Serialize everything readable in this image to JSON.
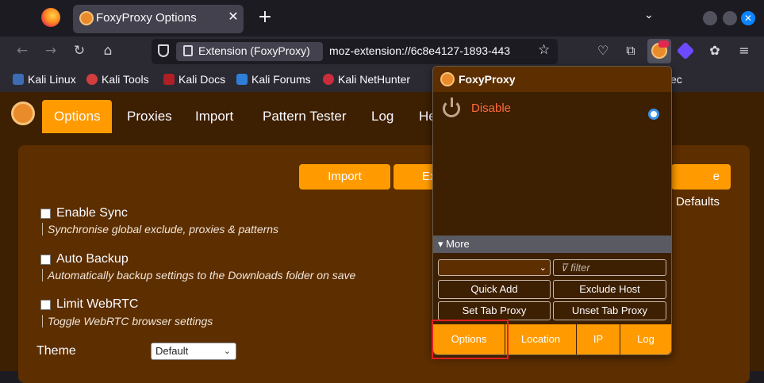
{
  "browser": {
    "tab": {
      "title": "FoxyProxy Options",
      "close_glyph": "✕"
    },
    "new_tab_glyph": "+",
    "list_tabs_glyph": "⌄",
    "window_close_glyph": "✕"
  },
  "navbar": {
    "back_glyph": "←",
    "forward_glyph": "→",
    "reload_glyph": "↻",
    "home_glyph": "⌂",
    "identity_label": "Extension (FoxyProxy)",
    "url": "moz-extension://6c8e4127-1893-443",
    "star_glyph": "☆",
    "pocket_glyph": "♡",
    "extensions_glyph": "⧉",
    "cookie_glyph": "✿",
    "menu_glyph": "≡"
  },
  "bookmarks": [
    {
      "label": "Kali Linux"
    },
    {
      "label": "Kali Tools"
    },
    {
      "label": "Kali Docs"
    },
    {
      "label": "Kali Forums"
    },
    {
      "label": "Kali NetHunter"
    },
    {
      "label": "ec"
    }
  ],
  "page": {
    "tabs": [
      {
        "label": "Options"
      },
      {
        "label": "Proxies"
      },
      {
        "label": "Import"
      },
      {
        "label": "Pattern Tester"
      },
      {
        "label": "Log"
      },
      {
        "label": "He"
      }
    ],
    "buttons": {
      "import": "Import",
      "export": "Ex",
      "defaults": "e Defaults"
    },
    "settings": [
      {
        "label": "Enable Sync",
        "description": "Synchronise global exclude, proxies & patterns"
      },
      {
        "label": "Auto Backup",
        "description": "Automatically backup settings to the Downloads folder on save"
      },
      {
        "label": "Limit WebRTC",
        "description": "Toggle WebRTC browser settings"
      }
    ],
    "theme": {
      "label": "Theme",
      "value": "Default",
      "caret": "⌄"
    }
  },
  "popup": {
    "title": "FoxyProxy",
    "mode": {
      "label": "Disable",
      "selected": true
    },
    "more_label": "▾ More",
    "select_caret": "⌄",
    "filter_placeholder": "⊽ filter",
    "buttons": {
      "quick_add": "Quick Add",
      "exclude_host": "Exclude Host",
      "set_tab_proxy": "Set Tab Proxy",
      "unset_tab_proxy": "Unset Tab Proxy"
    },
    "footer": [
      "Options",
      "Location",
      "IP",
      "Log"
    ]
  },
  "colors": {
    "accent": "#ff9b00",
    "page_bg": "#3d1f02",
    "panel_bg": "#5c2e00",
    "disable_text": "#ff6b3c",
    "highlight": "#e02020"
  }
}
